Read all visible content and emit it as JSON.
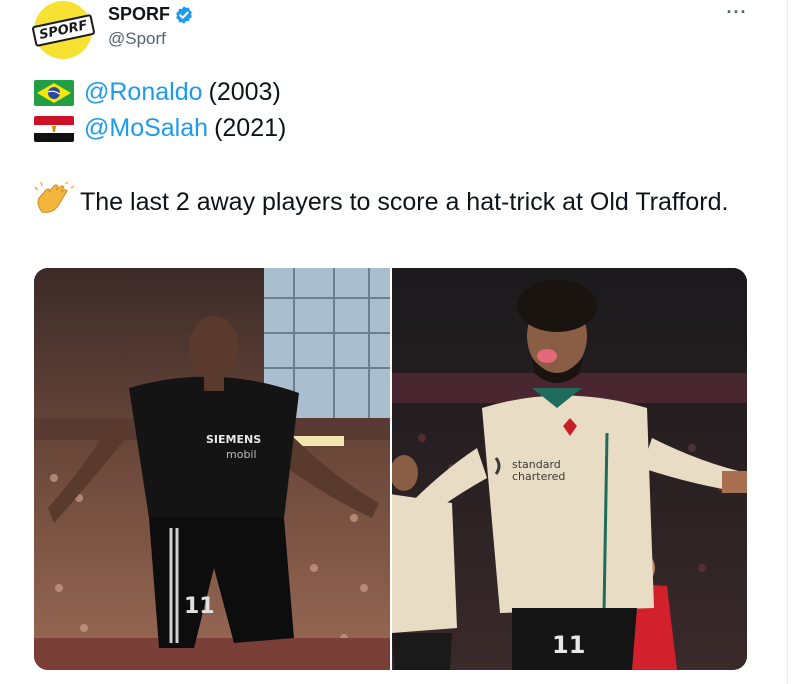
{
  "tweet": {
    "author": {
      "display_name": "SPORF",
      "handle": "@Sporf",
      "avatar_text": "SPORF",
      "verified_icon": "verified-badge-icon"
    },
    "more_label": "···",
    "lines": [
      {
        "flag": "brazil-flag-icon",
        "mention": "@Ronaldo",
        "year": "(2003)"
      },
      {
        "flag": "egypt-flag-icon",
        "mention": "@MoSalah",
        "year": "(2021)"
      }
    ],
    "text": "The last 2 away players to score a hat-trick at Old Trafford.",
    "text_emoji": "clapping-hands-icon",
    "media": [
      {
        "name": "ronaldo-photo",
        "shirt_sponsor": "SIEMENS mobile",
        "shirt_number": "11"
      },
      {
        "name": "salah-photo",
        "shirt_sponsor": "standard chartered",
        "shirt_number": "11"
      }
    ]
  },
  "colors": {
    "link": "#1d9bf0",
    "text": "#0f1419",
    "secondary": "#536471",
    "verified": "#1d9bf0",
    "avatar_bg": "#f7e233"
  }
}
